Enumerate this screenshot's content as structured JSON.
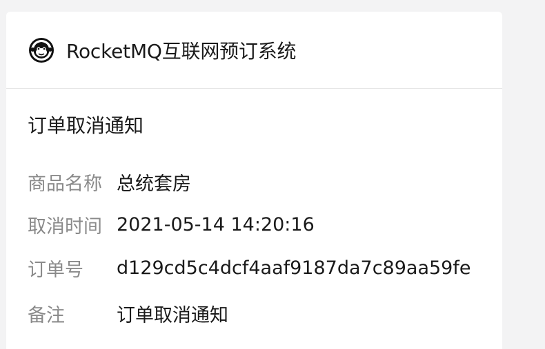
{
  "header": {
    "logo_icon": "monkey-logo-icon",
    "title": "RocketMQ互联网预订系统"
  },
  "notice": {
    "title": "订单取消通知",
    "rows": [
      {
        "label": "商品名称",
        "value": "总统套房"
      },
      {
        "label": "取消时间",
        "value": "2021-05-14 14:20:16"
      },
      {
        "label": "订单号",
        "value": "d129cd5c4dcf4aaf9187da7c89aa59fe"
      },
      {
        "label": "备注",
        "value": "订单取消通知"
      }
    ]
  },
  "colors": {
    "background": "#f3f3f4",
    "card": "#ffffff",
    "label": "#8a8a8a",
    "text": "#1a1a1a",
    "divider": "#e6e6e6"
  }
}
